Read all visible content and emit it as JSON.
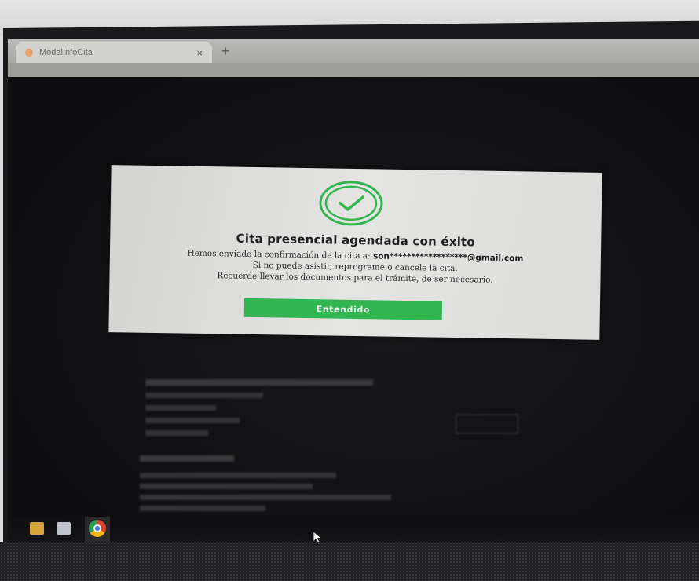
{
  "browser": {
    "tab_title": "ModalInfoCita",
    "tab_close": "×",
    "new_tab": "+"
  },
  "modal": {
    "icon": "check-circle-icon",
    "title": "Cita presencial agendada con éxito",
    "line1_prefix": "Hemos enviado la confirmación de la cita a:",
    "line1_email": "son******************@gmail.com",
    "line2": "Si no puede asistir, reprograme o cancele la cita.",
    "line3": "Recuerde llevar los documentos para el trámite, de ser necesario.",
    "button_label": "Entendido"
  },
  "colors": {
    "accent_green": "#33b552",
    "modal_bg": "#e0e0de",
    "screen_bg": "#1b1b1d"
  },
  "taskbar": {
    "icons": [
      "folder-icon",
      "store-icon",
      "chrome-icon"
    ]
  }
}
